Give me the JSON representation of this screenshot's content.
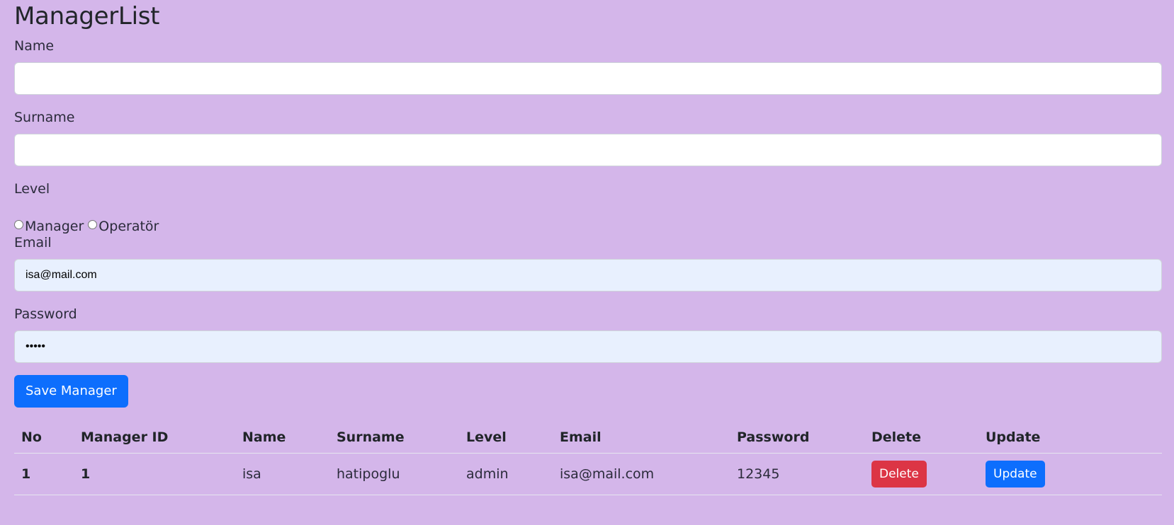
{
  "page": {
    "title": "ManagerList"
  },
  "form": {
    "name_label": "Name",
    "name_value": "",
    "surname_label": "Surname",
    "surname_value": "",
    "level_label": "Level",
    "level_options": [
      "Manager",
      "Operatör"
    ],
    "email_label": "Email",
    "email_value": "isa@mail.com",
    "password_label": "Password",
    "password_value": "•••••",
    "save_button": "Save Manager"
  },
  "table": {
    "headers": [
      "No",
      "Manager ID",
      "Name",
      "Surname",
      "Level",
      "Email",
      "Password",
      "Delete",
      "Update"
    ],
    "rows": [
      {
        "no": "1",
        "manager_id": "1",
        "name": "isa",
        "surname": "hatipoglu",
        "level": "admin",
        "email": "isa@mail.com",
        "password": "12345",
        "delete_label": "Delete",
        "update_label": "Update"
      }
    ]
  },
  "colors": {
    "background": "#d4b6ea",
    "primary": "#0d6efd",
    "danger": "#dc3545",
    "autofill": "#e8f0fe"
  }
}
